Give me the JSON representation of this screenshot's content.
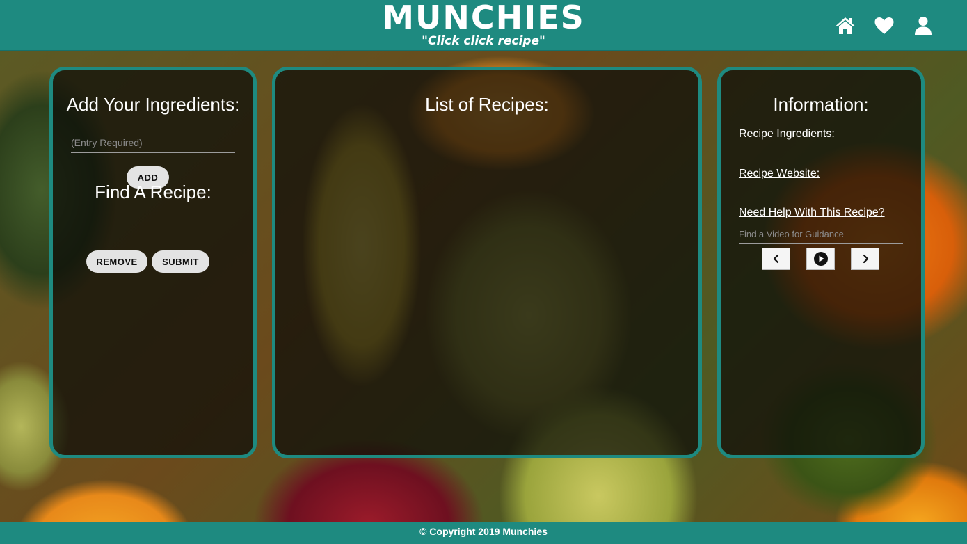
{
  "header": {
    "title": "MUNCHIES",
    "tagline": "\"Click click recipe\"",
    "nav": [
      {
        "icon": "home-icon"
      },
      {
        "icon": "heart-icon"
      },
      {
        "icon": "user-icon"
      }
    ]
  },
  "ingredients_panel": {
    "title": "Add Your Ingredients:",
    "input_placeholder": "(Entry Required)",
    "input_value": "",
    "add_label": "ADD",
    "find_title": "Find A Recipe:",
    "remove_label": "REMOVE",
    "submit_label": "SUBMIT"
  },
  "recipes_panel": {
    "title": "List of Recipes:"
  },
  "info_panel": {
    "title": "Information:",
    "ingredients_link": "Recipe Ingredients:",
    "website_link": "Recipe Website:",
    "help_link": "Need Help With This Recipe?",
    "video_placeholder": "Find a Video for Guidance",
    "video_controls": [
      {
        "icon": "chevron-left-icon"
      },
      {
        "icon": "play-icon"
      },
      {
        "icon": "chevron-right-icon"
      }
    ]
  },
  "footer": {
    "copyright": "© Copyright 2019 Munchies"
  },
  "colors": {
    "accent": "#1e8a80",
    "panel_bg": "#0c0c08",
    "button_bg": "#e3e3e3"
  }
}
